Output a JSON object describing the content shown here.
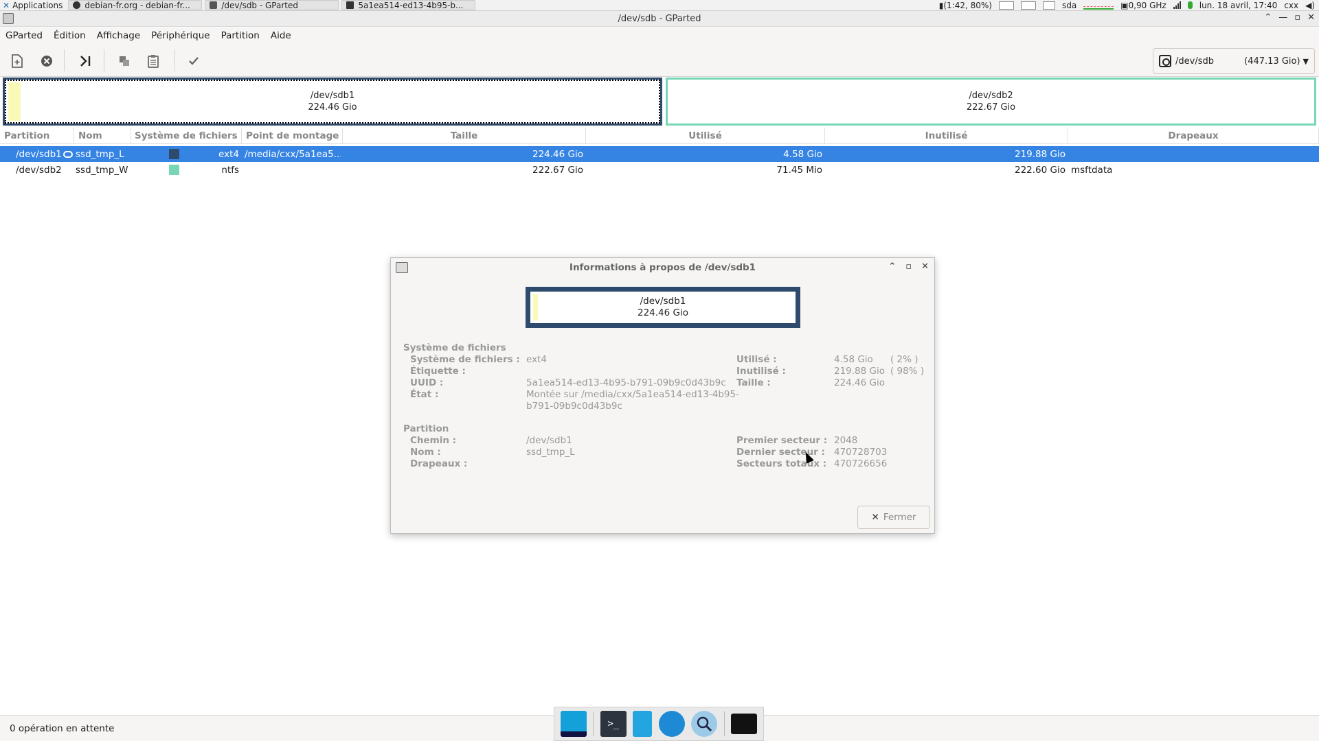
{
  "top_panel": {
    "applications": "Applications",
    "tasks": [
      "debian-fr.org - debian-fr...",
      "/dev/sdb - GParted",
      "5a1ea514-ed13-4b95-b..."
    ],
    "battery": "(1:42, 80%)",
    "disk_label": "sda",
    "cpu_freq": "0,90 GHz",
    "clock": "lun. 18 avril, 17:40",
    "user": "cxx"
  },
  "window": {
    "title": "/dev/sdb - GParted"
  },
  "menu": [
    "GParted",
    "Édition",
    "Affichage",
    "Périphérique",
    "Partition",
    "Aide"
  ],
  "toolbar": {
    "icons": [
      "new-partition-icon",
      "delete-icon",
      "resize-icon",
      "copy-icon",
      "paste-icon",
      "apply-icon"
    ],
    "device": "/dev/sdb",
    "device_size": "(447.13 Gio)"
  },
  "disk_graphic": [
    {
      "name": "/dev/sdb1",
      "size": "224.46 Gio",
      "color": "#2e4a6c"
    },
    {
      "name": "/dev/sdb2",
      "size": "222.67 Gio",
      "color": "#77d7b4"
    }
  ],
  "table": {
    "headers": [
      "Partition",
      "Nom",
      "Système de fichiers",
      "Point de montage",
      "Taille",
      "Utilisé",
      "Inutilisé",
      "Drapeaux"
    ],
    "rows": [
      {
        "partition": "/dev/sdb1",
        "name": "ssd_tmp_L",
        "fs_color": "#2e4a6c",
        "fs": "ext4",
        "mount": "/media/cxx/5a1ea5...",
        "size": "224.46 Gio",
        "used": "4.58 Gio",
        "unused": "219.88 Gio",
        "flags": ""
      },
      {
        "partition": "/dev/sdb2",
        "name": "ssd_tmp_W",
        "fs_color": "#77d7b4",
        "fs": "ntfs",
        "mount": "",
        "size": "222.67 Gio",
        "used": "71.45 Mio",
        "unused": "222.60 Gio",
        "flags": "msftdata"
      }
    ]
  },
  "dialog": {
    "title": "Informations à propos de /dev/sdb1",
    "graphic_name": "/dev/sdb1",
    "graphic_size": "224.46 Gio",
    "fs_section": "Système de fichiers",
    "fs_labels": [
      "Système de fichiers :",
      "Étiquette :",
      "UUID :",
      "État :"
    ],
    "fs_values": {
      "fs": "ext4",
      "label": "",
      "uuid": "5a1ea514-ed13-4b95-b791-09b9c0d43b9c",
      "state_line1": "Montée sur /media/cxx/5a1ea514-ed13-4b95-",
      "state_line2": "b791-09b9c0d43b9c"
    },
    "usage_labels": [
      "Utilisé :",
      "Inutilisé :",
      "Taille :"
    ],
    "usage_values": {
      "used": "4.58 Gio",
      "used_pct": "( 2% )",
      "unused": "219.88 Gio",
      "unused_pct": "( 98% )",
      "size": "224.46 Gio"
    },
    "part_section": "Partition",
    "part_labels": [
      "Chemin :",
      "Nom :",
      "Drapeaux :"
    ],
    "part_values": {
      "path": "/dev/sdb1",
      "name": "ssd_tmp_L",
      "flags": ""
    },
    "sector_labels": [
      "Premier secteur :",
      "Dernier secteur :",
      "Secteurs totaux :"
    ],
    "sector_values": {
      "first": "2048",
      "last": "470728703",
      "total": "470726656"
    },
    "close_label": "Fermer"
  },
  "status": "0 opération en attente",
  "dock": [
    "desktop-icon",
    "terminal-icon",
    "file-manager-icon",
    "web-browser-icon",
    "search-icon",
    "folder-icon"
  ]
}
